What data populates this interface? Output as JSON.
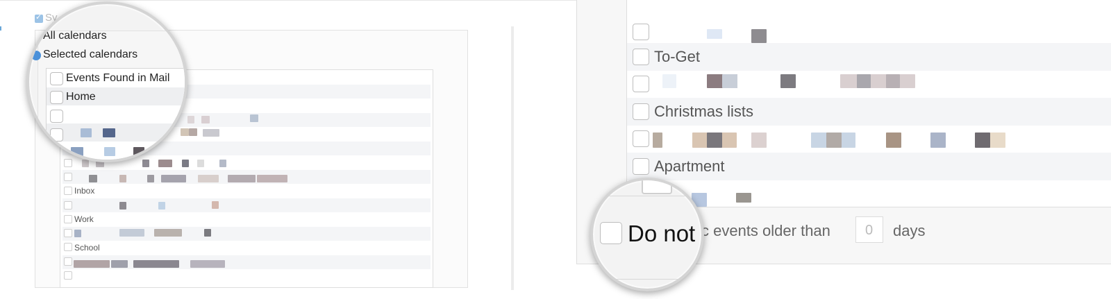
{
  "left_panel": {
    "sync_checkbox_label": "Sy",
    "magnifier": {
      "all_calendars": "All calendars",
      "selected_calendars": "Selected calendars",
      "calendars": [
        {
          "label": "Events Found in Mail"
        },
        {
          "label": "Home"
        }
      ]
    },
    "list_labels": {
      "inbox": "Inbox",
      "work": "Work",
      "school": "School"
    }
  },
  "right_panel": {
    "reminder_lists": [
      {
        "label": "To-Get"
      },
      {
        "label": "Christmas lists"
      },
      {
        "label": "Apartment"
      }
    ],
    "sync_option": {
      "magnified_text": "Do not",
      "text_after": "c events older than",
      "days_value": "0",
      "days_label": "days"
    }
  },
  "colors": {
    "accent": "#5b9bd5",
    "row_stripe": "#f4f5f7",
    "panel_border": "#dcdcdc"
  }
}
